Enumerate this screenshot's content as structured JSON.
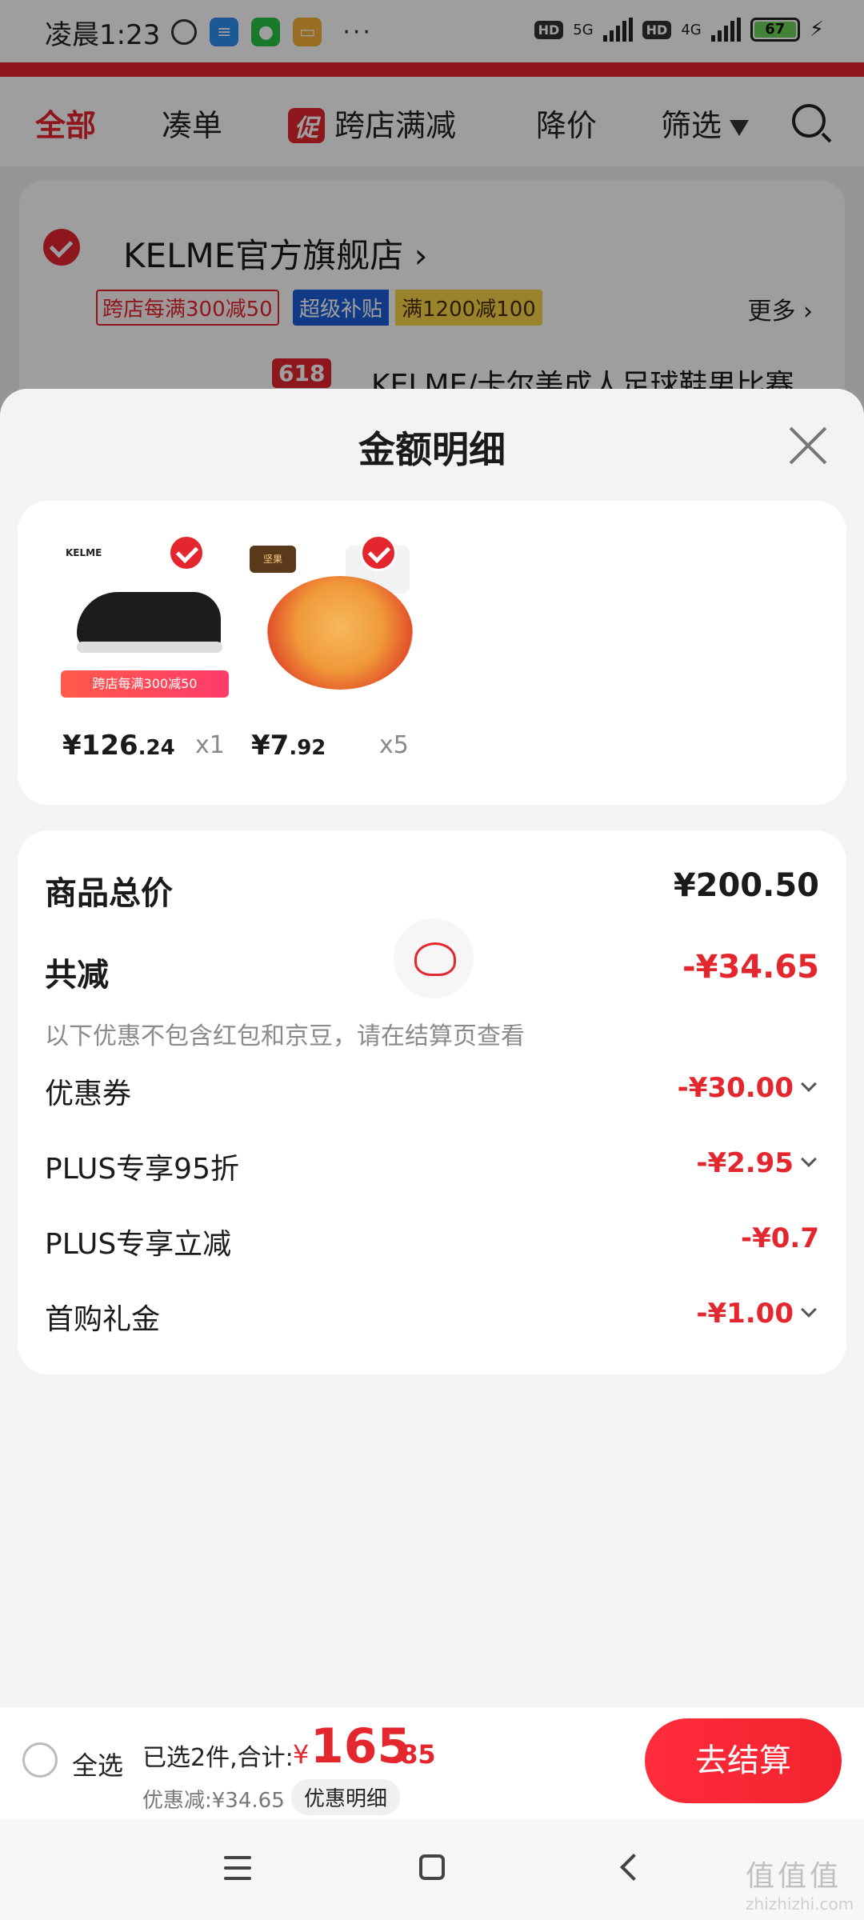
{
  "status_bar": {
    "time": "凌晨1:23",
    "more": "···",
    "hd1": "HD",
    "net1": "5G",
    "hd2": "HD",
    "net2": "4G",
    "battery": "67"
  },
  "top_nav": {
    "tabs": [
      {
        "label": "全部",
        "active": true
      },
      {
        "label": "凑单",
        "active": false
      },
      {
        "label": "跨店满减",
        "badge": "促",
        "active": false
      },
      {
        "label": "降价",
        "active": false
      },
      {
        "label": "筛选",
        "active": false
      }
    ]
  },
  "store": {
    "name": "KELME官方旗舰店",
    "name_arrow": "›",
    "tags": [
      "跨店每满300减50",
      "超级补贴",
      "满1200减100"
    ],
    "more": "更多 ›",
    "badge_618": "618",
    "product_peek": "KELME/卡尔美成人足球鞋男比赛"
  },
  "sheet": {
    "title": "金额明细",
    "products": [
      {
        "name": "KELME足球鞋",
        "logo": "KELME",
        "banner": "跨店每满300减50",
        "price_main": "¥126",
        "price_cents": ".24",
        "qty": "x1"
      },
      {
        "name": "香辣花生",
        "logo": "坚果",
        "price_main": "¥7",
        "price_cents": ".92",
        "qty": "x5"
      }
    ],
    "total_label": "商品总价",
    "total_value": "¥200.50",
    "reduce_label": "共减",
    "reduce_value": "-¥34.65",
    "note": "以下优惠不包含红包和京豆，请在结算页查看",
    "discounts": [
      {
        "label": "优惠券",
        "value": "-¥30.00",
        "expandable": true
      },
      {
        "label": "PLUS专享95折",
        "value": "-¥2.95",
        "expandable": true
      },
      {
        "label": "PLUS专享立减",
        "value": "-¥0.7",
        "expandable": false
      },
      {
        "label": "首购礼金",
        "value": "-¥1.00",
        "expandable": true
      }
    ]
  },
  "bottom_bar": {
    "select_all": "全选",
    "summary": "已选2件,合计:",
    "yen": "¥",
    "total_main": "165",
    "total_cents": ".85",
    "discount": "优惠减:¥34.65",
    "detail_button": "优惠明细",
    "checkout": "去结算"
  },
  "watermark": {
    "main": "值值值",
    "sub": "zhizhizhi.com"
  },
  "colors": {
    "accent": "#e4262e",
    "checkout_gradient_start": "#ff2c3c"
  }
}
